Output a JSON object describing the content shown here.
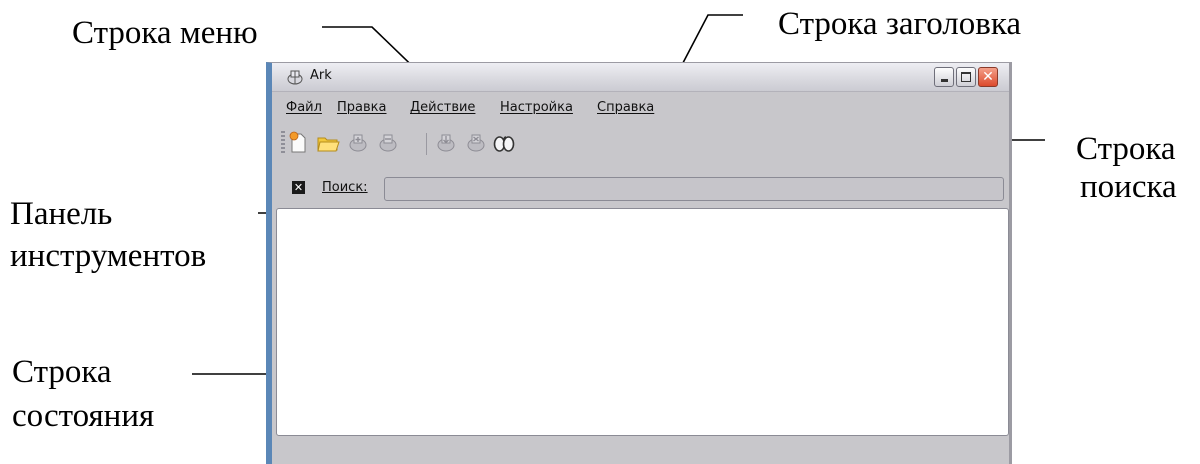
{
  "annotations": {
    "menubar": "Строка меню",
    "titlebar": "Строка заголовка",
    "searchbar_line1": "Строка",
    "searchbar_line2": "поиска",
    "toolbar_line1": "Панель",
    "toolbar_line2": "инструментов",
    "statusbar_line1": "Строка",
    "statusbar_line2": "состояния"
  },
  "window": {
    "title": "Ark",
    "controls": [
      "minimize",
      "maximize",
      "close"
    ],
    "close_glyph": "✕"
  },
  "menu": [
    "Файл",
    "Правка",
    "Действие",
    "Настройка",
    "Справка"
  ],
  "toolbar": {
    "buttons": [
      "new-archive-icon",
      "open-folder-icon",
      "add-file-icon",
      "add-folder-icon",
      "extract-icon",
      "delete-icon",
      "view-icon"
    ]
  },
  "search": {
    "clear_glyph": "✕",
    "label": "Поиск:",
    "value": ""
  },
  "status": {
    "text": ""
  },
  "colors": {
    "window_bg": "#c8c7cb",
    "left_border": "#5b87b7",
    "close_button": "#dc4a2c"
  }
}
